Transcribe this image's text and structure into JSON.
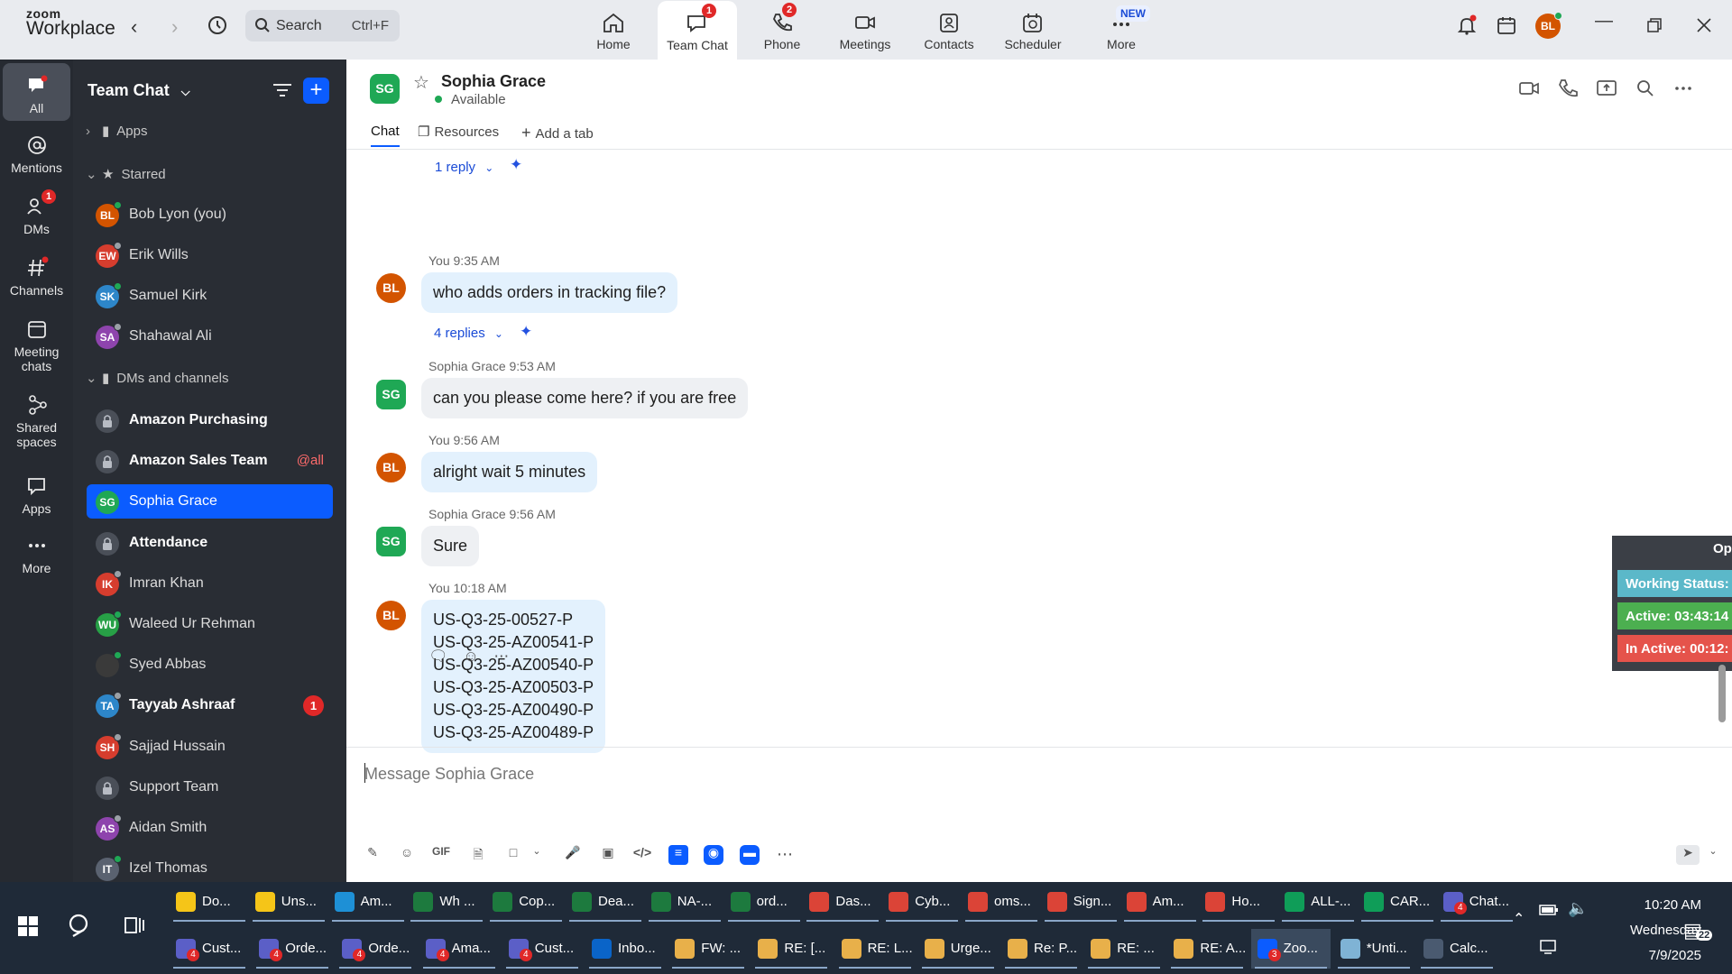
{
  "app": {
    "logo_line1": "zoom",
    "logo_line2": "Workplace"
  },
  "search": {
    "label": "Search",
    "shortcut": "Ctrl+F"
  },
  "top_nav": [
    {
      "label": "Home",
      "badge": ""
    },
    {
      "label": "Team Chat",
      "badge": "1"
    },
    {
      "label": "Phone",
      "badge": "2"
    },
    {
      "label": "Meetings",
      "badge": ""
    },
    {
      "label": "Contacts",
      "badge": ""
    },
    {
      "label": "Scheduler",
      "badge": ""
    },
    {
      "label": "More",
      "badge": ""
    }
  ],
  "new_label": "NEW",
  "user_initials": "BL",
  "rail": [
    {
      "label": "All"
    },
    {
      "label": "Mentions"
    },
    {
      "label": "DMs",
      "badge": "1"
    },
    {
      "label": "Channels"
    },
    {
      "label": "Meeting chats"
    },
    {
      "label": "Shared spaces"
    },
    {
      "label": "Apps"
    },
    {
      "label": "More"
    }
  ],
  "sidebar": {
    "title": "Team Chat",
    "sections": {
      "apps": "Apps",
      "starred": "Starred",
      "dms": "DMs and channels"
    },
    "starred": [
      {
        "initials": "BL",
        "name": "Bob Lyon (you)",
        "color": "#d35400",
        "status": "#1fa855"
      },
      {
        "initials": "EW",
        "name": "Erik Wills",
        "color": "#d63d2e",
        "status": "#9aa0a6"
      },
      {
        "initials": "SK",
        "name": "Samuel Kirk",
        "color": "#2d86c9",
        "status": "#1fa855"
      },
      {
        "initials": "SA",
        "name": "Shahawal Ali",
        "color": "#8e44ad",
        "status": "#9aa0a6"
      }
    ],
    "channels": [
      {
        "type": "lock",
        "name": "Amazon Purchasing",
        "bold": true
      },
      {
        "type": "lock",
        "name": "Amazon Sales Team",
        "bold": true,
        "mention": "@all"
      },
      {
        "type": "avatar",
        "initials": "SG",
        "name": "Sophia Grace",
        "color": "#1fa855",
        "selected": true
      },
      {
        "type": "lock",
        "name": "Attendance",
        "bold": true
      },
      {
        "type": "avatar",
        "initials": "IK",
        "name": "Imran Khan",
        "color": "#d63d2e",
        "status": "#9aa0a6"
      },
      {
        "type": "avatar",
        "initials": "WU",
        "name": "Waleed Ur Rehman",
        "color": "#27a046",
        "status": "#1fa855"
      },
      {
        "type": "avatar",
        "initials": "",
        "name": "Syed Abbas",
        "color": "#3a3a3a",
        "status": "#1fa855"
      },
      {
        "type": "avatar",
        "initials": "TA",
        "name": "Tayyab Ashraaf",
        "color": "#2d86c9",
        "bold": true,
        "count": "1",
        "status": "#9aa0a6"
      },
      {
        "type": "avatar",
        "initials": "SH",
        "name": "Sajjad Hussain",
        "color": "#d63d2e",
        "status": "#9aa0a6"
      },
      {
        "type": "lock",
        "name": "Support Team"
      },
      {
        "type": "avatar",
        "initials": "AS",
        "name": "Aidan Smith",
        "color": "#8e44ad",
        "status": "#9aa0a6"
      },
      {
        "type": "avatar",
        "initials": "IT",
        "name": "Izel Thomas",
        "color": "#5a6270",
        "status": "#1fa855"
      }
    ]
  },
  "chat": {
    "name": "Sophia Grace",
    "initials": "SG",
    "status": "Available",
    "tabs": [
      "Chat",
      "Resources",
      "Add a tab"
    ],
    "top_reply": "1 reply",
    "messages": [
      {
        "who": "BL",
        "meta": "You 9:35 AM",
        "lines": [
          "who adds orders in tracking file?"
        ],
        "replies": "4 replies"
      },
      {
        "who": "SG",
        "meta": "Sophia Grace 9:53 AM",
        "lines": [
          "can you please come here? if you are free"
        ]
      },
      {
        "who": "BL",
        "meta": "You 9:56 AM",
        "lines": [
          "alright wait 5 minutes"
        ]
      },
      {
        "who": "SG",
        "meta": "Sophia Grace 9:56 AM",
        "lines": [
          "Sure"
        ]
      },
      {
        "who": "BL",
        "meta": "You 10:18 AM",
        "lines": [
          "US-Q3-25-00527-P",
          "US-Q3-25-AZ00541-P",
          "US-Q3-25-AZ00540-P",
          "US-Q3-25-AZ00503-P",
          "US-Q3-25-AZ00490-P",
          "US-Q3-25-AZ00489-P"
        ]
      }
    ],
    "compose_placeholder": "Message Sophia Grace",
    "gif_label": "GIF"
  },
  "widget": {
    "top": "Op",
    "rows": [
      {
        "text": "Working Status:",
        "color": "#5bb8c9"
      },
      {
        "text": "Active: 03:43:14",
        "color": "#4caf50"
      },
      {
        "text": "In Active: 00:12:",
        "color": "#e5534b"
      }
    ]
  },
  "taskbar": {
    "row1": [
      {
        "label": "Do...",
        "icon": "folder-icon",
        "color": "#f5c518"
      },
      {
        "label": "Uns...",
        "icon": "folder-icon",
        "color": "#f5c518"
      },
      {
        "label": "Am...",
        "icon": "edge-icon",
        "color": "#1e90d6"
      },
      {
        "label": "Wh ...",
        "icon": "excel-icon",
        "color": "#1d7a3e"
      },
      {
        "label": "Cop...",
        "icon": "excel-icon",
        "color": "#1d7a3e"
      },
      {
        "label": "Dea...",
        "icon": "excel-icon",
        "color": "#1d7a3e"
      },
      {
        "label": "NA-...",
        "icon": "excel-icon",
        "color": "#1d7a3e"
      },
      {
        "label": "ord...",
        "icon": "excel-icon",
        "color": "#1d7a3e"
      },
      {
        "label": "Das...",
        "icon": "chrome-icon",
        "color": "#db4437"
      },
      {
        "label": "Cyb...",
        "icon": "chrome-icon",
        "color": "#db4437"
      },
      {
        "label": "oms...",
        "icon": "chrome-icon",
        "color": "#db4437"
      },
      {
        "label": "Sign...",
        "icon": "chrome-icon",
        "color": "#db4437"
      },
      {
        "label": "Am...",
        "icon": "chrome-icon",
        "color": "#db4437"
      },
      {
        "label": "Ho...",
        "icon": "chrome-icon",
        "color": "#db4437"
      },
      {
        "label": "ALL-...",
        "icon": "chrome-icon",
        "color": "#0f9d58"
      },
      {
        "label": "CAR...",
        "icon": "chrome-icon",
        "color": "#0f9d58"
      },
      {
        "label": "Chat...",
        "icon": "teams-icon",
        "color": "#5b5fc7",
        "badge": "4"
      }
    ],
    "row2": [
      {
        "label": "Cust...",
        "icon": "teams-icon",
        "color": "#5b5fc7",
        "badge": "4"
      },
      {
        "label": "Orde...",
        "icon": "teams-icon",
        "color": "#5b5fc7",
        "badge": "4"
      },
      {
        "label": "Orde...",
        "icon": "teams-icon",
        "color": "#5b5fc7",
        "badge": "4"
      },
      {
        "label": "Ama...",
        "icon": "teams-icon",
        "color": "#5b5fc7",
        "badge": "4"
      },
      {
        "label": "Cust...",
        "icon": "teams-icon",
        "color": "#5b5fc7",
        "badge": "4"
      },
      {
        "label": "Inbo...",
        "icon": "outlook-icon",
        "color": "#0a64c8"
      },
      {
        "label": "FW: ...",
        "icon": "mail-icon",
        "color": "#e8b04a"
      },
      {
        "label": "RE: [...",
        "icon": "mail-icon",
        "color": "#e8b04a"
      },
      {
        "label": "RE: L...",
        "icon": "mail-icon",
        "color": "#e8b04a"
      },
      {
        "label": "Urge...",
        "icon": "mail-icon",
        "color": "#e8b04a"
      },
      {
        "label": "Re: P...",
        "icon": "mail-icon",
        "color": "#e8b04a"
      },
      {
        "label": "RE: ...",
        "icon": "mail-icon",
        "color": "#e8b04a"
      },
      {
        "label": "RE: A...",
        "icon": "mail-icon",
        "color": "#e8b04a"
      },
      {
        "label": "Zoo...",
        "icon": "zoom-icon",
        "color": "#0b5cff",
        "badge": "3",
        "active": true
      },
      {
        "label": "*Unti...",
        "icon": "notepad-icon",
        "color": "#7fb3d5"
      },
      {
        "label": "Calc...",
        "icon": "calculator-icon",
        "color": "#4a5a70"
      }
    ],
    "time": "10:20 AM",
    "day": "Wednesday",
    "date": "7/9/2025",
    "notif_count": "22"
  }
}
